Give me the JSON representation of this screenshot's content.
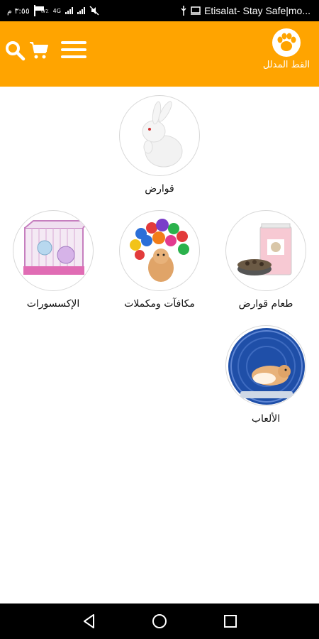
{
  "status_bar": {
    "time": "٣:٥٥ م",
    "battery_percent": "٦٧٪",
    "network_label": "4G",
    "carrier": "Etisalat- Stay Safe|mo..."
  },
  "app_bar": {
    "logo_text": "القط المدلل",
    "icons": [
      "search-icon",
      "cart-icon",
      "menu-icon",
      "paw-icon"
    ],
    "background_color": "#ffa400"
  },
  "categories": [
    {
      "label": "قوارض",
      "icon": "rabbit-image"
    },
    {
      "label": "طعام قوارض",
      "icon": "rodent-food-image"
    },
    {
      "label": "مكافآت ومكملات",
      "icon": "vitamins-hamster-image"
    },
    {
      "label": "الإكسسورات",
      "icon": "cage-image"
    },
    {
      "label": "الألعاب",
      "icon": "hamster-wheel-image"
    }
  ],
  "nav_bar": {
    "icons": [
      "back-icon",
      "home-icon",
      "recents-icon"
    ]
  }
}
